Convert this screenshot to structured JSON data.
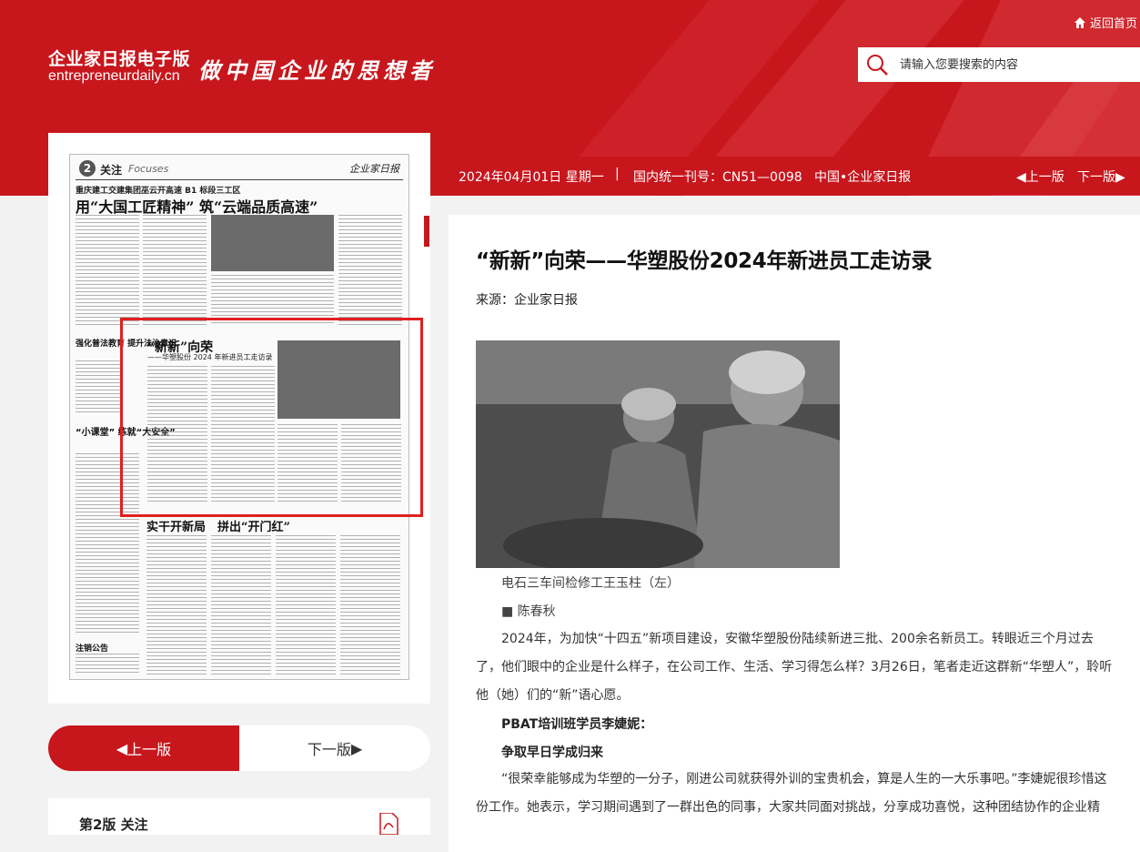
{
  "header": {
    "brand_title": "企业家日报电子版",
    "brand_url": "entrepreneurdaily.cn",
    "slogan": "做中国企业的思想者",
    "back_link": "返回首页",
    "search_placeholder": "请输入您要搜索的内容"
  },
  "infobar": {
    "date": "2024年04月01日 星期一",
    "separator": "|",
    "issn": "国内统一刊号：CN51—0098",
    "paper_name": "中国•企业家日报",
    "prev": "上一版",
    "next": "下一版"
  },
  "newspaper_page": {
    "page_number": "2",
    "section": "关注",
    "section_en": "Focuses",
    "logo": "企业家日报",
    "top_subtitle": "重庆建工交建集团巫云开高速 B1 标段三工区",
    "top_headline": "用“大国工匠精神” 筑“云端品质高速”",
    "selected_title": "“新新”向荣",
    "selected_subtitle": "——华塑股份 2024 年新进员工走访录",
    "bottom_headline": "实干开新局　拼出“开门红”",
    "side_title_1": "强化普法教育 提升法治意识",
    "side_title_2": "“小课堂” 练就“大安全”",
    "notice_title": "注销公告"
  },
  "pager": {
    "prev": "上一版",
    "next": "下一版"
  },
  "section_list": {
    "title": "第2版 关注"
  },
  "article": {
    "title": "“新新”向荣——华塑股份2024年新进员工走访录",
    "source": "来源：企业家日报",
    "photo_caption": "电石三车间检修工王玉柱（左）",
    "author": "■ 陈春秋",
    "para1": "2024年，为加快“十四五”新项目建设，安徽华塑股份陆续新进三批、200余名新员工。转眼近三个月过去了，他们眼中的企业是什么样子，在公司工作、生活、学习得怎么样？3月26日，笔者走近这群新“华塑人”，聆听他（她）们的“新”语心愿。",
    "sub1": "PBAT培训班学员李婕妮：",
    "sub2": "争取早日学成归来",
    "para2": "“很荣幸能够成为华塑的一分子，刚进公司就获得外训的宝贵机会，算是人生的一大乐事吧。”李婕妮很珍惜这份工作。她表示，学习期间遇到了一群出色的同事，大家共同面对挑战，分享成功喜悦，这种团结协作的企业精"
  },
  "colors": {
    "brand_red": "#c8161d",
    "selection_red": "#e02020"
  }
}
